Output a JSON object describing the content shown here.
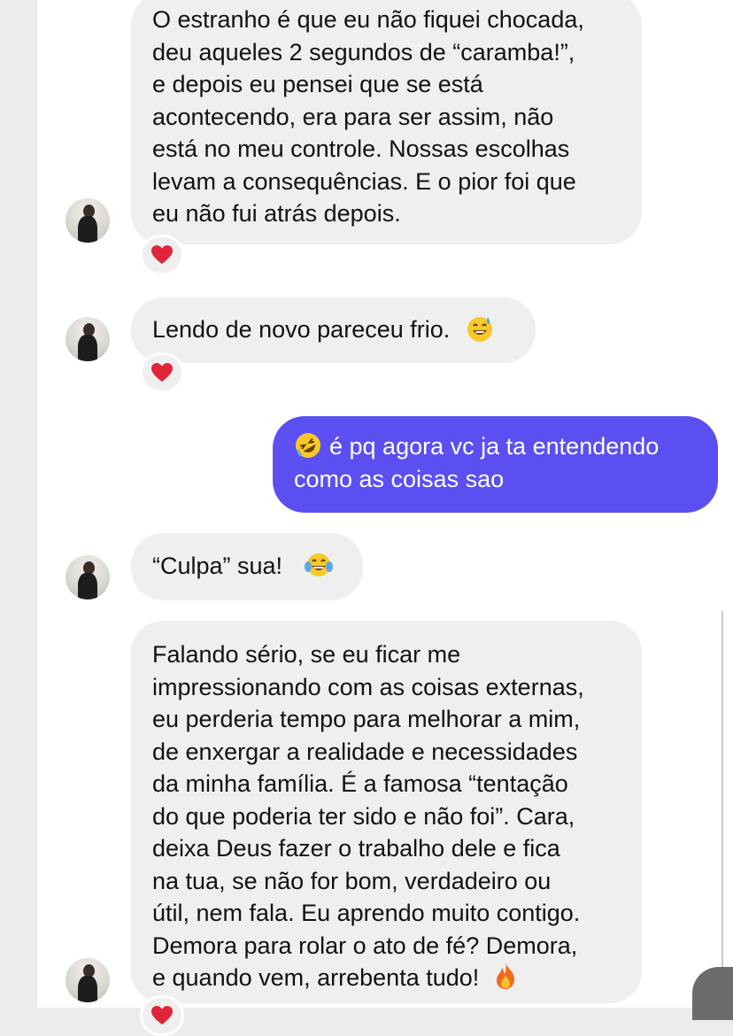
{
  "messages": [
    {
      "lines": [
        "O estranho é que eu não fiquei chocada,",
        "deu aqueles 2 segundos de “caramba!”,",
        "e depois eu pensei que se está",
        "acontecendo, era para ser assim, não",
        "está no meu controle. Nossas escolhas",
        "levam a consequências. E o pior foi que",
        "eu não fui atrás depois."
      ],
      "reaction": "heart-emoji"
    },
    {
      "text": "Lendo de novo pareceu frio.",
      "emoji": "sweat-smile-emoji",
      "reaction": "heart-emoji"
    },
    {
      "emoji": "rolling-on-floor-laughing-emoji",
      "lines": [
        "é pq agora vc ja ta entendendo",
        "como as coisas sao"
      ]
    },
    {
      "text": "“Culpa” sua!",
      "emoji": "tears-of-joy-emoji"
    },
    {
      "lines": [
        "Falando sério, se eu ficar me",
        "impressionando com as coisas externas,",
        "eu perderia tempo para melhorar a mim,",
        "de enxergar a realidade e necessidades",
        "da minha família. É a famosa “tentação",
        "do que poderia ter sido e não foi”. Cara,",
        "deixa Deus fazer o trabalho dele e fica",
        "na tua, se não for bom, verdadeiro ou",
        "útil, nem fala. Eu aprendo muito contigo.",
        "Demora para rolar o ato de fé? Demora,",
        "e quando vem, arrebenta tudo!"
      ],
      "emoji": "fire-emoji",
      "reaction": "heart-emoji"
    }
  ],
  "colors": {
    "received_bubble": "#efefef",
    "sent_bubble": "#5b4ff2",
    "heart": "#e0243a"
  }
}
